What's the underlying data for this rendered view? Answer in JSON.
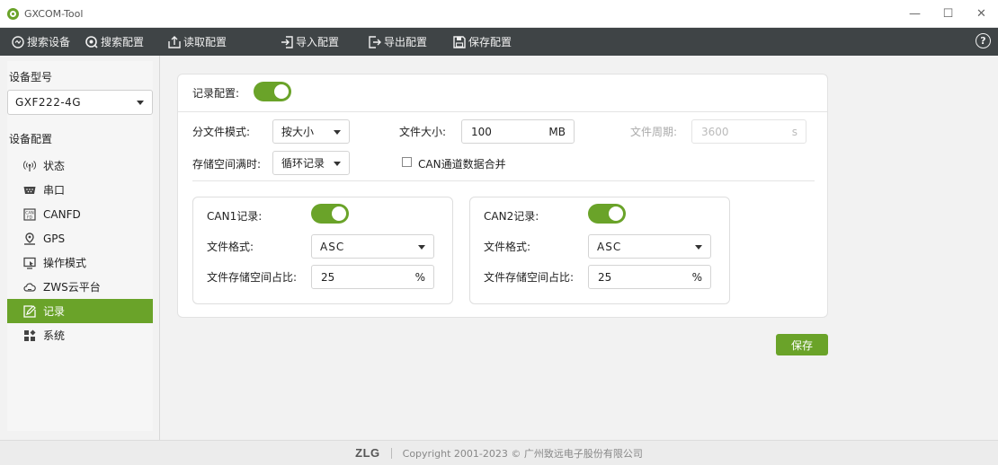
{
  "window": {
    "title": "GXCOM-Tool",
    "minimize": "—",
    "maximize": "☐",
    "close": "✕"
  },
  "toolbar": {
    "items": [
      {
        "label": "搜索设备",
        "icon": "search-device-icon"
      },
      {
        "label": "搜索配置",
        "icon": "search-config-icon"
      },
      {
        "label": "读取配置",
        "icon": "read-config-icon"
      },
      {
        "label": "导入配置",
        "icon": "import-config-icon"
      },
      {
        "label": "导出配置",
        "icon": "export-config-icon"
      },
      {
        "label": "保存配置",
        "icon": "save-config-icon"
      }
    ],
    "help": "?"
  },
  "sidebar": {
    "model_heading": "设备型号",
    "model_value": "GXF222-4G",
    "config_heading": "设备配置",
    "items": [
      {
        "label": "状态",
        "icon": "signal-icon"
      },
      {
        "label": "串口",
        "icon": "serial-port-icon"
      },
      {
        "label": "CANFD",
        "icon": "canfd-icon"
      },
      {
        "label": "GPS",
        "icon": "gps-pin-icon"
      },
      {
        "label": "操作模式",
        "icon": "operation-mode-icon"
      },
      {
        "label": "ZWS云平台",
        "icon": "cloud-icon"
      },
      {
        "label": "记录",
        "icon": "record-icon",
        "active": true
      },
      {
        "label": "系统",
        "icon": "system-grid-icon"
      }
    ]
  },
  "record": {
    "enable_label": "记录配置:",
    "enabled": true,
    "split_mode_label": "分文件模式:",
    "split_mode_value": "按大小",
    "file_size_label": "文件大小:",
    "file_size_value": "100",
    "file_size_unit": "MB",
    "file_period_label": "文件周期:",
    "file_period_value": "3600",
    "file_period_unit": "s",
    "storage_full_label": "存储空间满时:",
    "storage_full_value": "循环记录",
    "merge_label": "CAN通道数据合并",
    "merge_checked": false,
    "channels": [
      {
        "record_label": "CAN1记录:",
        "enabled": true,
        "format_label": "文件格式:",
        "format_value": "ASC",
        "ratio_label": "文件存储空间占比:",
        "ratio_value": "25",
        "ratio_unit": "%"
      },
      {
        "record_label": "CAN2记录:",
        "enabled": true,
        "format_label": "文件格式:",
        "format_value": "ASC",
        "ratio_label": "文件存储空间占比:",
        "ratio_value": "25",
        "ratio_unit": "%"
      }
    ],
    "save_label": "保存"
  },
  "footer": {
    "logo": "ZLG",
    "copyright": "Copyright  2001-2023 © 广州致远电子股份有限公司"
  },
  "colors": {
    "accent": "#6aa329",
    "toolbar_bg": "#3f4446"
  }
}
